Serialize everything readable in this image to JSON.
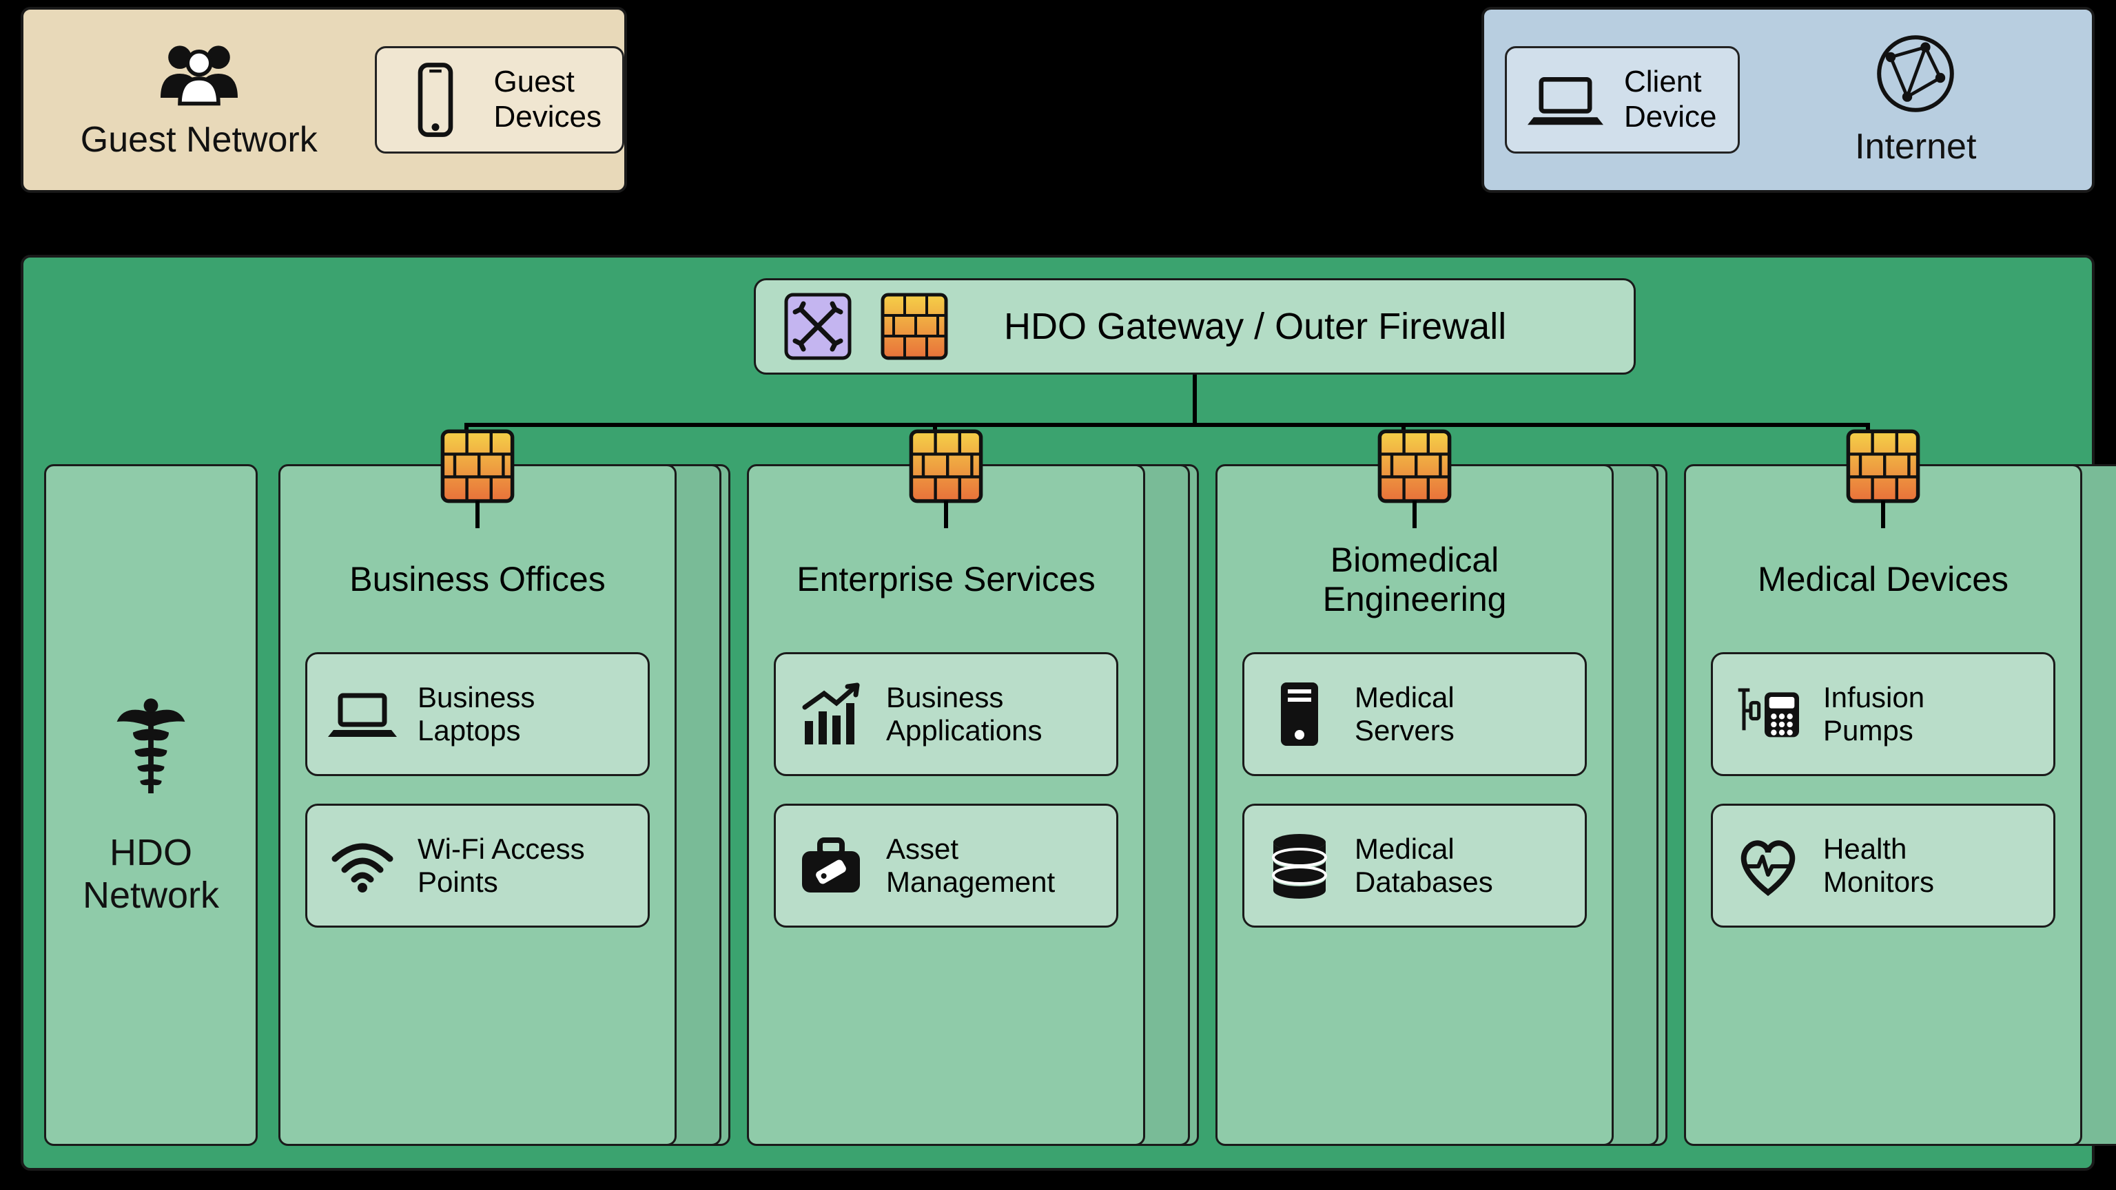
{
  "top": {
    "guest": {
      "title": "Guest Network",
      "device": "Guest\nDevices"
    },
    "internet": {
      "title": "Internet",
      "device": "Client\nDevice"
    }
  },
  "gateway": {
    "label": "HDO Gateway / Outer Firewall"
  },
  "hdo": {
    "side_label": "HDO\nNetwork"
  },
  "segments": [
    {
      "title": "Business Offices",
      "items": [
        {
          "icon": "laptop",
          "label": "Business\nLaptops"
        },
        {
          "icon": "wifi",
          "label": "Wi-Fi Access\nPoints"
        }
      ]
    },
    {
      "title": "Enterprise Services",
      "items": [
        {
          "icon": "chart",
          "label": "Business\nApplications"
        },
        {
          "icon": "bag",
          "label": "Asset\nManagement"
        }
      ]
    },
    {
      "title": "Biomedical\nEngineering",
      "items": [
        {
          "icon": "server",
          "label": "Medical\nServers"
        },
        {
          "icon": "database",
          "label": "Medical\nDatabases"
        }
      ]
    },
    {
      "title": "Medical Devices",
      "items": [
        {
          "icon": "pump",
          "label": "Infusion\nPumps"
        },
        {
          "icon": "heart",
          "label": "Health\nMonitors"
        }
      ]
    }
  ]
}
